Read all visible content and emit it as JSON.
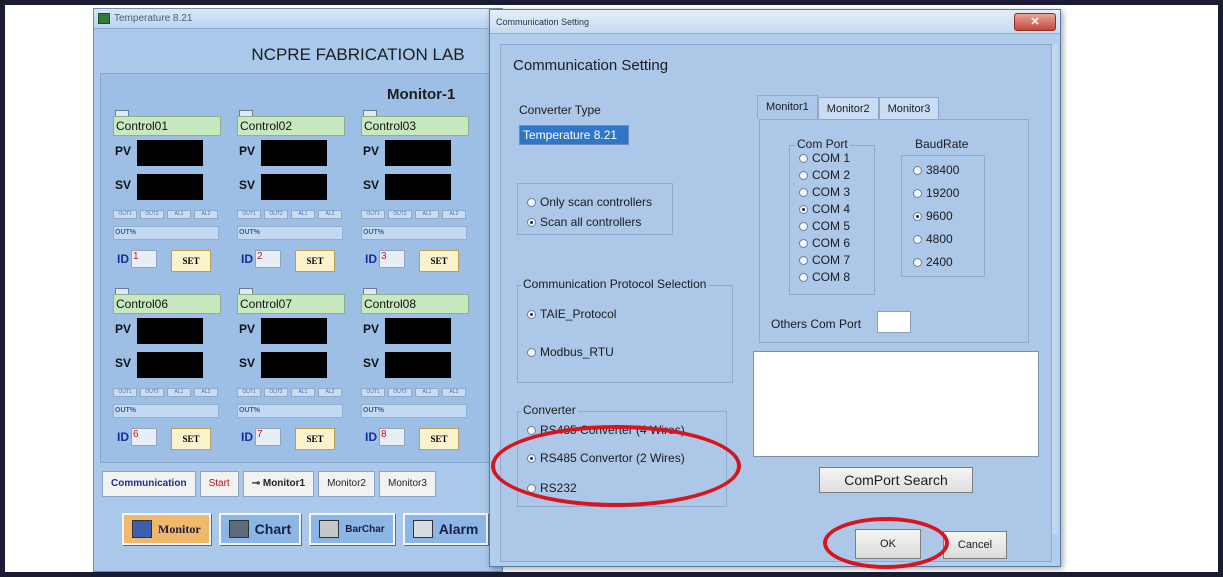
{
  "main_window": {
    "title": "Temperature 8.21",
    "lab_title": "NCPRE FABRICATION LAB",
    "monitor_title": "Monitor-1",
    "controllers": [
      {
        "name": "Control01",
        "id": "1"
      },
      {
        "name": "Control02",
        "id": "2"
      },
      {
        "name": "Control03",
        "id": "3"
      },
      {
        "name": "Control06",
        "id": "6"
      },
      {
        "name": "Control07",
        "id": "7"
      },
      {
        "name": "Control08",
        "id": "8"
      }
    ],
    "pv_label": "PV",
    "sv_label": "SV",
    "led_labels": [
      "OUT1",
      "OUT2",
      "AL1",
      "AL2"
    ],
    "out_label": "OUT%",
    "id_label": "ID",
    "set_label": "SET",
    "tabs": [
      "Communication",
      "Start",
      "Monitor1",
      "Monitor2",
      "Monitor3"
    ],
    "big_buttons": [
      "Monitor",
      "Chart",
      "BarChar",
      "Alarm"
    ]
  },
  "dialog": {
    "window_title": "Communication Setting",
    "close_label": "✕",
    "heading": "Communication Setting",
    "converter_type_label": "Converter Type",
    "converter_type_value": "Temperature 8.21",
    "scan_options": [
      {
        "label": "Only scan controllers",
        "selected": false
      },
      {
        "label": "Scan all controllers",
        "selected": true
      }
    ],
    "protocol": {
      "title": "Communication Protocol Selection",
      "options": [
        {
          "label": "TAIE_Protocol",
          "selected": true
        },
        {
          "label": "Modbus_RTU",
          "selected": false
        }
      ]
    },
    "converter": {
      "title": "Converter",
      "options": [
        {
          "label": "RS485 Converter (4 Wires)",
          "selected": false
        },
        {
          "label": "RS485 Convertor (2 Wires)",
          "selected": true
        },
        {
          "label": "RS232",
          "selected": false
        }
      ]
    },
    "monitor_tabs": [
      "Monitor1",
      "Monitor2",
      "Monitor3"
    ],
    "com_port": {
      "title": "Com Port",
      "options": [
        {
          "label": "COM 1",
          "selected": false
        },
        {
          "label": "COM 2",
          "selected": false
        },
        {
          "label": "COM 3",
          "selected": false
        },
        {
          "label": "COM 4",
          "selected": true
        },
        {
          "label": "COM 5",
          "selected": false
        },
        {
          "label": "COM 6",
          "selected": false
        },
        {
          "label": "COM 7",
          "selected": false
        },
        {
          "label": "COM 8",
          "selected": false
        }
      ]
    },
    "baud_rate": {
      "title": "BaudRate",
      "options": [
        {
          "label": "38400",
          "selected": false
        },
        {
          "label": "19200",
          "selected": false
        },
        {
          "label": "9600",
          "selected": true
        },
        {
          "label": "4800",
          "selected": false
        },
        {
          "label": "2400",
          "selected": false
        }
      ]
    },
    "others_com_port_label": "Others Com Port",
    "comport_search_label": "ComPort Search",
    "ok_label": "OK",
    "cancel_label": "Cancel"
  },
  "colors": {
    "highlight": "#d5161f",
    "panel_bg": "#acc7e7",
    "selected_text_bg": "#2f75c8"
  }
}
